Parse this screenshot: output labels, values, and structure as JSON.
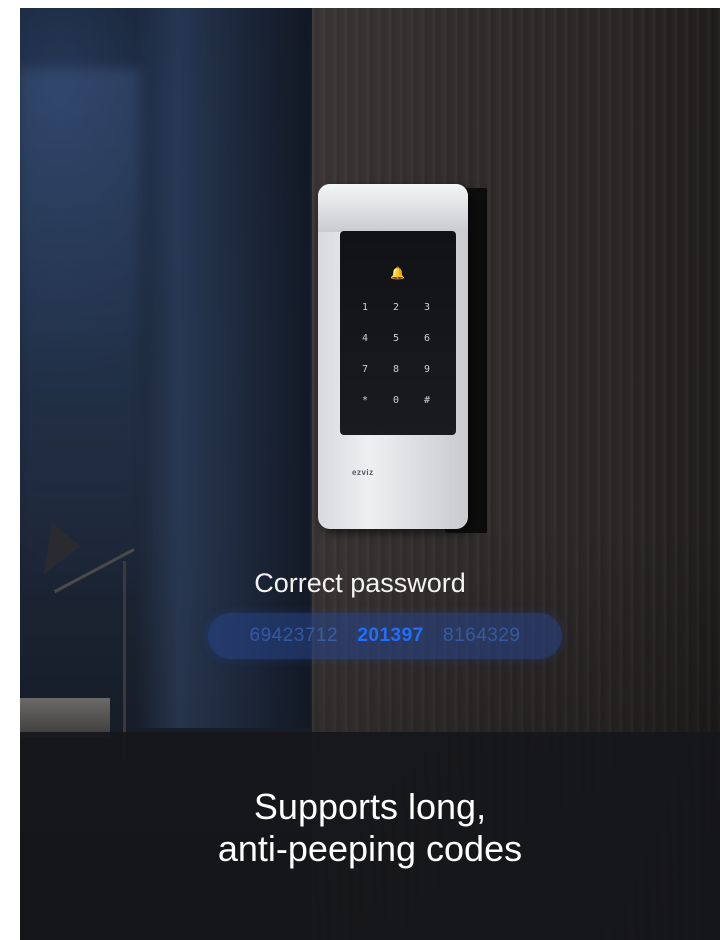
{
  "caption": "Correct password",
  "password_strip": {
    "prefix_noise": "69423712",
    "password": "201397",
    "suffix_noise": "8164329"
  },
  "headline": {
    "line1": "Supports long,",
    "line2": "anti-peeping codes"
  },
  "device": {
    "keys": [
      "1",
      "2",
      "3",
      "4",
      "5",
      "6",
      "7",
      "8",
      "9",
      "*",
      "0",
      "#"
    ],
    "bell_icon": "bell-icon",
    "brand_logo": "ezviz"
  },
  "colors": {
    "password_highlight": "#1f6fff",
    "pill_background": "#28468c",
    "band_background": "#16171a"
  }
}
